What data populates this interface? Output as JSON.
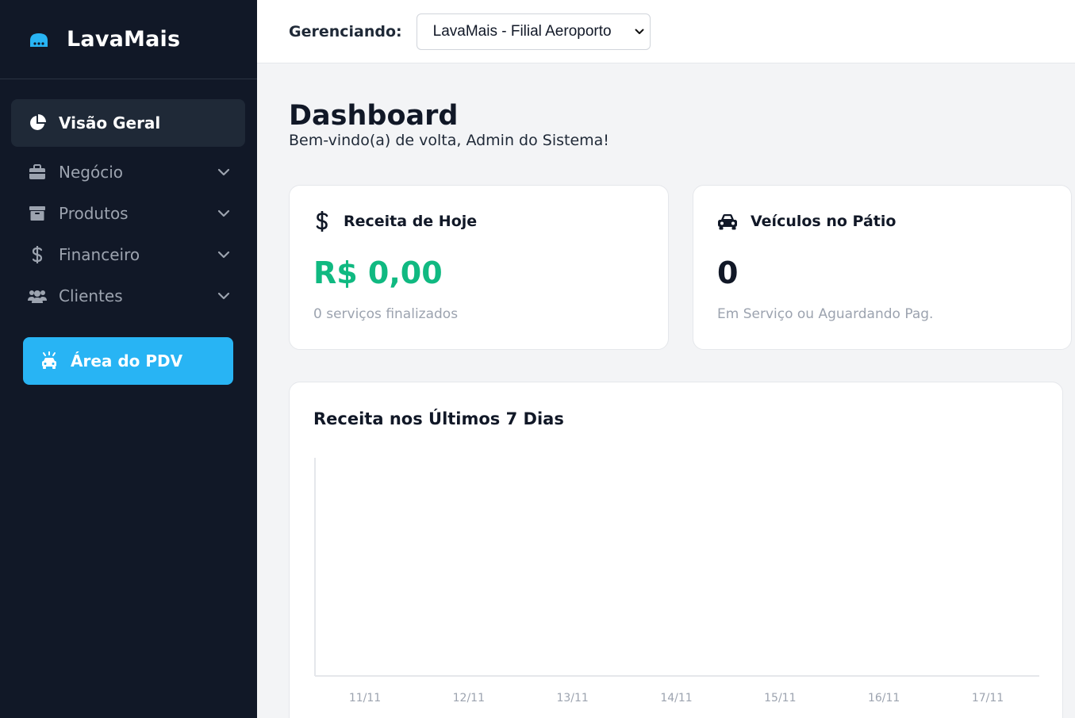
{
  "brand": {
    "name": "LavaMais",
    "icon": "car-wash-icon",
    "accent": "#28b4f4"
  },
  "sidebar": {
    "items": [
      {
        "label": "Visão Geral",
        "icon": "pie-chart-icon",
        "active": true
      },
      {
        "label": "Negócio",
        "icon": "briefcase-icon"
      },
      {
        "label": "Produtos",
        "icon": "archive-box-icon"
      },
      {
        "label": "Financeiro",
        "icon": "dollar-icon"
      },
      {
        "label": "Clientes",
        "icon": "users-icon"
      }
    ],
    "pdv_button": {
      "label": "Área do PDV",
      "icon": "car-wash-icon"
    }
  },
  "header": {
    "label": "Gerenciando:",
    "selected_branch": "LavaMais - Filial Aeroporto"
  },
  "main": {
    "title": "Dashboard",
    "subtitle": "Bem-vindo(a) de volta, Admin do Sistema!"
  },
  "cards": [
    {
      "title": "Receita de Hoje",
      "icon": "dollar-icon",
      "value": "R$ 0,00",
      "note": "0 serviços finalizados",
      "value_color": "#10b981"
    },
    {
      "title": "Veículos no Pátio",
      "icon": "car-icon",
      "value": "0",
      "note": "Em Serviço ou Aguardando Pag."
    }
  ],
  "chart_data": {
    "type": "line",
    "title": "Receita nos Últimos 7 Dias",
    "categories": [
      "11/11",
      "12/11",
      "13/11",
      "14/11",
      "15/11",
      "16/11",
      "17/11"
    ],
    "series": [
      {
        "values": [
          0,
          0,
          0,
          0,
          0,
          0,
          0
        ]
      }
    ],
    "xlabel": "",
    "ylabel": "",
    "grid": false
  }
}
